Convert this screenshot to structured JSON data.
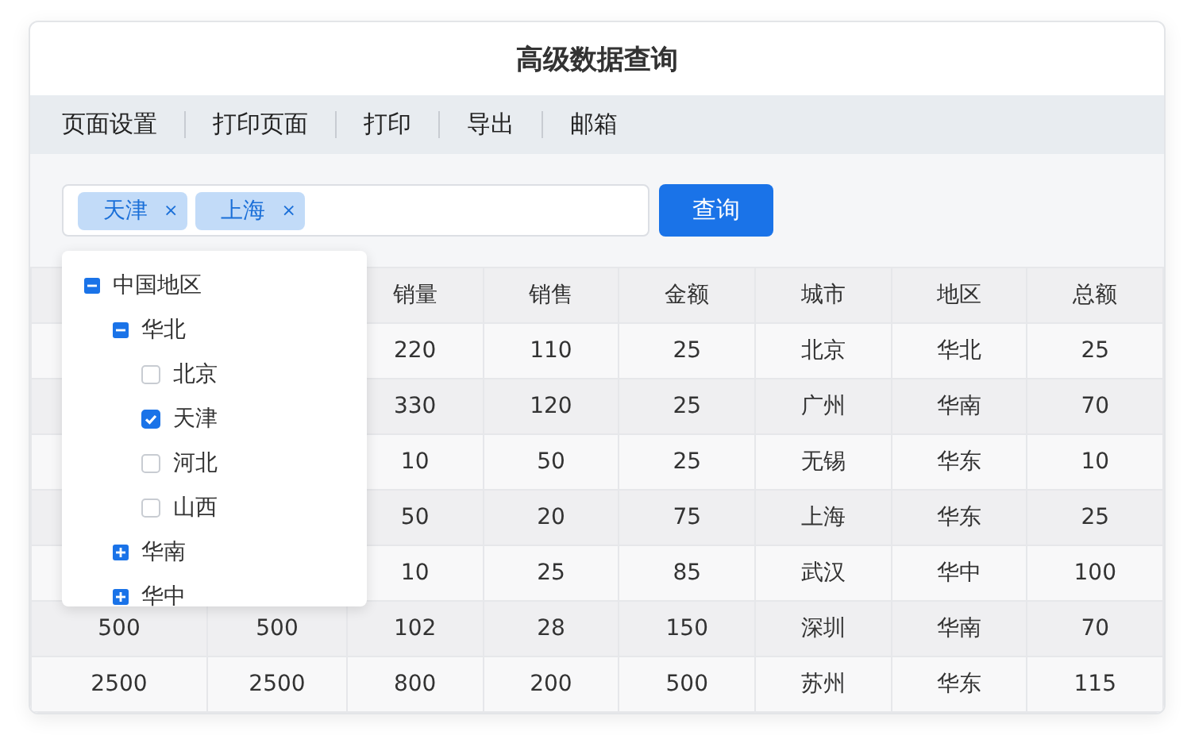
{
  "window": {
    "title": "高级数据查询"
  },
  "toolbar": [
    "页面设置",
    "打印页面",
    "打印",
    "导出",
    "邮箱"
  ],
  "query": {
    "tags": [
      {
        "label": "天津",
        "close": "×"
      },
      {
        "label": "上海",
        "close": "×"
      }
    ],
    "button": "查询"
  },
  "tree": [
    {
      "label": "中国地区",
      "expanded": true,
      "children": [
        {
          "label": "华北",
          "expanded": true,
          "children": [
            {
              "label": "北京",
              "checked": false
            },
            {
              "label": "天津",
              "checked": true
            },
            {
              "label": "河北",
              "checked": false
            },
            {
              "label": "山西",
              "checked": false
            }
          ]
        },
        {
          "label": "华南",
          "expanded": false
        },
        {
          "label": "华中",
          "expanded": false
        }
      ]
    }
  ],
  "table": {
    "columns": [
      null,
      null,
      "销量",
      "销售",
      "金额",
      "城市",
      "地区",
      "总额"
    ],
    "rows": [
      [
        null,
        null,
        "220",
        "110",
        "25",
        "北京",
        "华北",
        "25"
      ],
      [
        null,
        null,
        "330",
        "120",
        "25",
        "广州",
        "华南",
        "70"
      ],
      [
        null,
        null,
        "10",
        "50",
        "25",
        "无锡",
        "华东",
        "10"
      ],
      [
        null,
        null,
        "50",
        "20",
        "75",
        "上海",
        "华东",
        "25"
      ],
      [
        null,
        null,
        "10",
        "25",
        "85",
        "武汉",
        "华中",
        "100"
      ],
      [
        "500",
        "500",
        "102",
        "28",
        "150",
        "深圳",
        "华南",
        "70"
      ],
      [
        "2500",
        "2500",
        "800",
        "200",
        "500",
        "苏州",
        "华东",
        "115"
      ]
    ]
  }
}
